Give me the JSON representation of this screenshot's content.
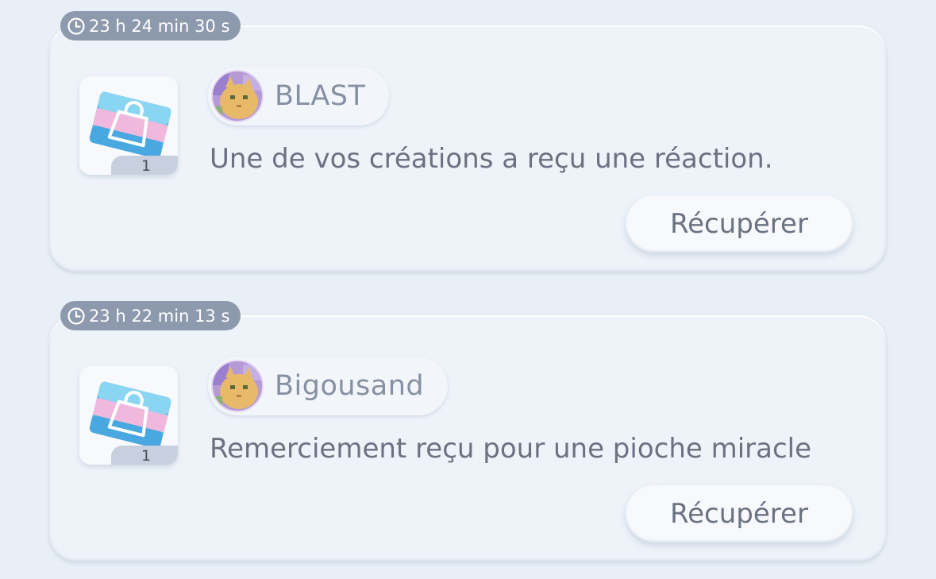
{
  "colors": {
    "background": "#e9eff6",
    "card": "#eef3f9",
    "timer_badge": "#8d99ad",
    "text": "#6a7181",
    "sender_text": "#8590a3"
  },
  "notifications": [
    {
      "timer": "23 h 24 min 30 s",
      "timer_icon": "clock-icon",
      "item_icon": "shopping-bag-card-icon",
      "item_quantity": "1",
      "sender": "BLAST",
      "message": "Une de vos créations a reçu une réaction.",
      "button_label": "Récupérer"
    },
    {
      "timer": "23 h 22 min 13 s",
      "timer_icon": "clock-icon",
      "item_icon": "shopping-bag-card-icon",
      "item_quantity": "1",
      "sender": "Bigousand",
      "message": "Remerciement reçu pour une pioche miracle",
      "button_label": "Récupérer"
    }
  ]
}
